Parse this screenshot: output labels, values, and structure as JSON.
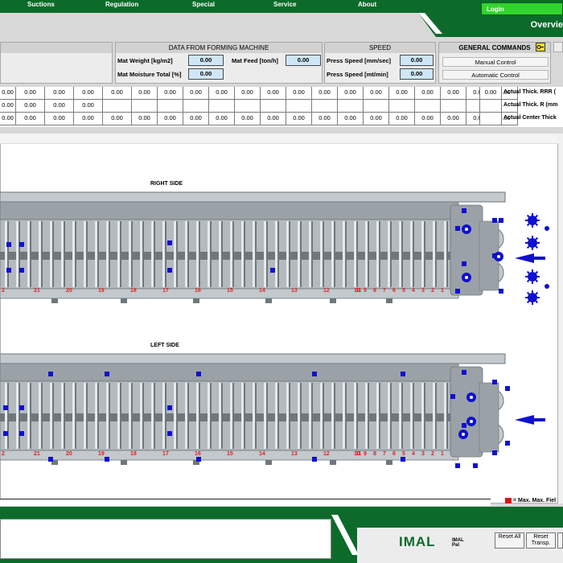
{
  "menu": [
    "Suctions",
    "Regulation",
    "Special",
    "Service",
    "About"
  ],
  "login_label": "Login",
  "page_title": "Overvie",
  "forming": {
    "header": "DATA FROM FORMING MACHINE",
    "mat_weight_label": "Mat Weight [kg/m2]",
    "mat_weight_value": "0.00",
    "mat_feed_label": "Mat Feed [ton/h]",
    "mat_feed_value": "0.00",
    "mat_moisture_label": "Mat Moisture Total [%]",
    "mat_moisture_value": "0.00"
  },
  "speed": {
    "header": "SPEED",
    "press_mm_label": "Press Speed [mm/sec]",
    "press_mm_value": "0.00",
    "press_mt_label": "Press Speed [mt/min]",
    "press_mt_value": "0.00"
  },
  "commands": {
    "header": "GENERAL COMMANDS",
    "manual": "Manual Control",
    "automatic": "Automatic Control"
  },
  "table": {
    "rows": [
      {
        "label": "Actual Thick. RRR (",
        "values": [
          "0.00",
          "0.00",
          "0.00",
          "0.00",
          "0.00",
          "0.00",
          "0.00",
          "0.00",
          "0.00",
          "0.00",
          "0.00",
          "0.00",
          "0.00",
          "0.00",
          "0.00",
          "0.00",
          "0.00",
          "0.00",
          "0.00",
          "0.00"
        ],
        "extra": "0.00"
      },
      {
        "label": "Actual Thick. R (mm",
        "values": [
          "0.00",
          "0.00",
          "0.00",
          "0.00",
          "",
          "",
          "",
          "",
          "",
          "",
          "",
          "",
          "",
          "",
          "",
          "",
          "",
          "",
          "",
          ""
        ],
        "extra": ""
      },
      {
        "label": "Actual Center Thick",
        "values": [
          "0.00",
          "0.00",
          "0.00",
          "0.00",
          "0.00",
          "0.00",
          "0.00",
          "0.00",
          "0.00",
          "0.00",
          "0.00",
          "0.00",
          "0.00",
          "0.00",
          "0.00",
          "0.00",
          "0.00",
          "0.00",
          "0.00",
          "0.00"
        ],
        "extra": ""
      }
    ]
  },
  "diagram": {
    "right_title": "RIGHT SIDE",
    "left_title": "LEFT SIDE",
    "frame_numbers": [
      "2",
      "21",
      "20",
      "19",
      "18",
      "17",
      "16",
      "15",
      "14",
      "13",
      "12",
      "11",
      "10",
      "9",
      "8",
      "7",
      "6",
      "5",
      "4",
      "3",
      "2",
      "1"
    ]
  },
  "legend_text": "= Max. Max. Fiel",
  "brand": "IMAL",
  "brand_sub": "IMAL Pal",
  "buttons": {
    "reset_all": "Reset All",
    "reset_transp": "Reset Transp."
  },
  "colors": {
    "topbar": "#0c6b2a",
    "login": "#31d42d",
    "value_bg": "#cfe6f7",
    "press_gray": "#9aa2a8",
    "marker": "#1010d0",
    "numbers": "#e02222"
  }
}
